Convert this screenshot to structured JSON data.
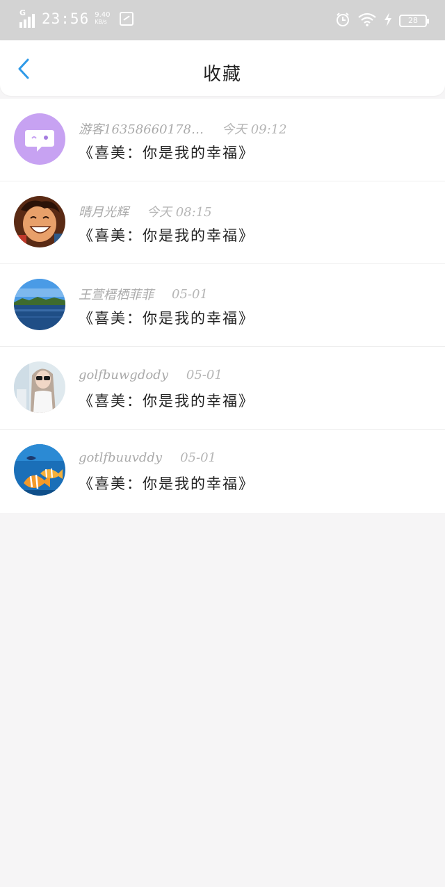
{
  "status_bar": {
    "network": "G",
    "time": "23:56",
    "speed": "9.40",
    "speed_unit": "KB/s",
    "battery": "28"
  },
  "header": {
    "title": "收藏"
  },
  "favorites": [
    {
      "user": "游客16358660178…",
      "time": "今天 09:12",
      "title": "《喜美：你是我的幸福》",
      "avatar": "chat-bubble-avatar"
    },
    {
      "user": "晴月光辉",
      "time": "今天 08:15",
      "title": "《喜美：你是我的幸福》",
      "avatar": "anime-character-avatar"
    },
    {
      "user": "王萱榗栖菲菲",
      "time": "05-01",
      "title": "《喜美：你是我的幸福》",
      "avatar": "landscape-avatar"
    },
    {
      "user": "golfbuwgdody",
      "time": "05-01",
      "title": "《喜美：你是我的幸福》",
      "avatar": "girl-photo-avatar"
    },
    {
      "user": "gotlfbuuvddy",
      "time": "05-01",
      "title": "《喜美：你是我的幸福》",
      "avatar": "fish-avatar"
    }
  ],
  "colors": {
    "accent": "#2f9ae8",
    "status_bar_bg": "#d3d3d3",
    "page_bg": "#f6f5f6"
  }
}
